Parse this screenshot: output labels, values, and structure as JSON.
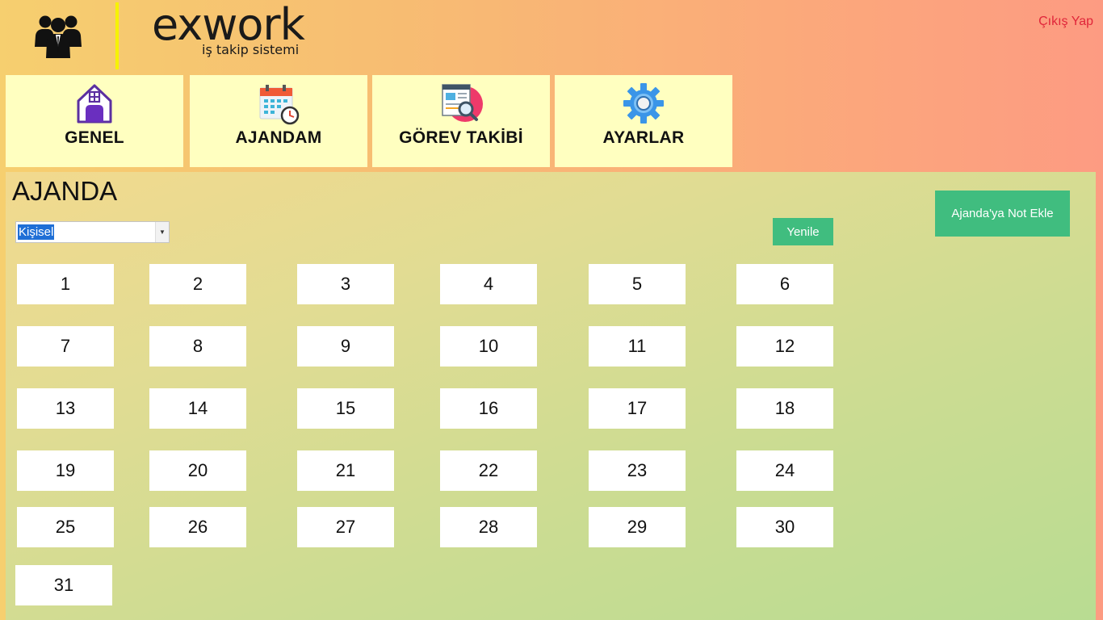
{
  "header": {
    "brand": "exwork",
    "brand_sub": "iş takip sistemi",
    "logout": "Çıkış Yap",
    "logo_icon": "users-group-icon"
  },
  "nav": [
    {
      "label": "GENEL",
      "icon": "home-icon"
    },
    {
      "label": "AJANDAM",
      "icon": "calendar-icon"
    },
    {
      "label": "GÖREV TAKİBİ",
      "icon": "search-document-icon"
    },
    {
      "label": "AYARLAR",
      "icon": "gear-icon"
    }
  ],
  "agenda": {
    "title": "AJANDA",
    "filter_value": "Kişisel",
    "refresh_label": "Yenile",
    "add_note_label": "Ajanda'ya Not Ekle",
    "days": [
      "1",
      "2",
      "3",
      "4",
      "5",
      "6",
      "7",
      "8",
      "9",
      "10",
      "11",
      "12",
      "13",
      "14",
      "15",
      "16",
      "17",
      "18",
      "19",
      "20",
      "21",
      "22",
      "23",
      "24",
      "25",
      "26",
      "27",
      "28",
      "29",
      "30",
      "31"
    ]
  },
  "colors": {
    "accent_green": "#40bd7f",
    "nav_tile_bg": "#ffffc0",
    "logout_red": "#e0263a",
    "divider_yellow": "#f6f200"
  }
}
